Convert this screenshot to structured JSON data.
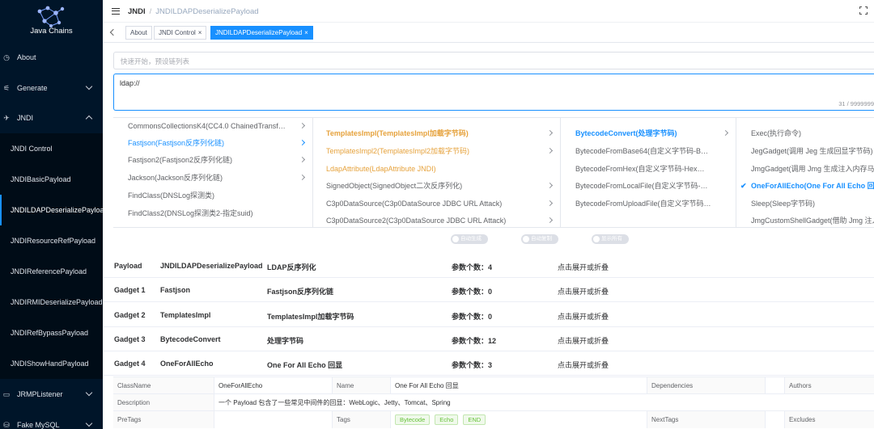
{
  "app": {
    "name": "Java Chains"
  },
  "sidebar": {
    "items": [
      {
        "label": "About",
        "icon": "clock-icon"
      },
      {
        "label": "Generate",
        "icon": "generate-icon"
      },
      {
        "label": "JNDI",
        "icon": "rocket-icon"
      },
      {
        "label": "JNDI Control"
      },
      {
        "label": "JNDIBasicPayload"
      },
      {
        "label": "JNDILDAPDeserializePayload"
      },
      {
        "label": "JNDIResourceRefPayload"
      },
      {
        "label": "JNDIReferencePayload"
      },
      {
        "label": "JNDIRMIDeserializePayload"
      },
      {
        "label": "JNDIRefBypassPayload"
      },
      {
        "label": "JNDIShowHandPayload"
      },
      {
        "label": "JRMPListener",
        "icon": "listener-icon"
      },
      {
        "label": "Fake MySQL",
        "icon": "database-icon"
      }
    ]
  },
  "header": {
    "crumb_root": "JNDI",
    "crumb_sep": "/",
    "crumb_current": "JNDILDAPDeserializePayload"
  },
  "tags": [
    {
      "label": "About"
    },
    {
      "label": "JNDI Control",
      "close": "×"
    },
    {
      "label": "JNDILDAPDeserializePayload",
      "close": "×"
    }
  ],
  "search": {
    "placeholder": "快速开始，预设链列表"
  },
  "editor": {
    "value": "ldap://",
    "count": "31 / 9999999"
  },
  "cascader": {
    "col1": [
      "CommonsCollectionsK4(CC4.0 ChainedTransfor…",
      "Fastjson(Fastjson反序列化链)",
      "Fastjson2(Fastjson2反序列化链)",
      "Jackson(Jackson反序列化链)",
      "FindClass(DNSLog探测类)",
      "FindClass2(DNSLog探测类2-指定suid)"
    ],
    "col2": [
      "TemplatesImpl(TemplatesImpl加载字节码)",
      "TemplatesImpl2(TemplatesImpl2加载字节码)",
      "LdapAttribute(LdapAttribute JNDI)",
      "SignedObject(SignedObject二次反序列化)",
      "C3p0DataSource(C3p0DataSource JDBC URL Attack)",
      "C3p0DataSource2(C3p0DataSource JDBC URL Attack)"
    ],
    "col3": [
      "BytecodeConvert(处理字节码)",
      "BytecodeFromBase64(自定义字节码-Bas…",
      "BytecodeFromHex(自定义字节码-Hex字符…",
      "BytecodeFromLocalFile(自定义字节码-本…",
      "BytecodeFromUploadFile(自定义字节码-…"
    ],
    "col4": [
      "Exec(执行命令)",
      "JegGadget(调用 Jeg 生成回显字节码)",
      "JmgGadget(调用 Jmg 生成注入内存马字节码)",
      "OneForAllEcho(One For All Echo 回显)",
      "Sleep(Sleep字节码)",
      "JmgCustomShellGadget(借助 Jmg 注入自定义内存马)"
    ],
    "check": "✔"
  },
  "switches": [
    "自动生成",
    "自动复制",
    "显示所有"
  ],
  "chains": [
    {
      "kind": "Payload",
      "name": "JNDILDAPDeserializePayload",
      "desc": "LDAP反序列化",
      "params": "参数个数：4",
      "toggle": "点击展开或折叠"
    },
    {
      "kind": "Gadget 1",
      "name": "Fastjson",
      "desc": "Fastjson反序列化链",
      "params": "参数个数：0",
      "toggle": "点击展开或折叠"
    },
    {
      "kind": "Gadget 2",
      "name": "TemplatesImpl",
      "desc": "TemplatesImpl加载字节码",
      "params": "参数个数：0",
      "toggle": "点击展开或折叠"
    },
    {
      "kind": "Gadget 3",
      "name": "BytecodeConvert",
      "desc": "处理字节码",
      "params": "参数个数：12",
      "toggle": "点击展开或折叠"
    },
    {
      "kind": "Gadget 4",
      "name": "OneForAllEcho",
      "desc": "One For All Echo 回显",
      "params": "参数个数：3",
      "toggle": "点击展开或折叠"
    }
  ],
  "detail": {
    "classname_label": "ClassName",
    "classname": "OneForAllEcho",
    "name_label": "Name",
    "name": "One For All Echo 回显",
    "dependencies_label": "Dependencies",
    "authors_label": "Authors",
    "description_label": "Description",
    "description": "一个 Payload 包含了一些常见中间件的回显：WebLogic、Jetty、Tomcat、Spring",
    "pretags_label": "PreTags",
    "tags_label": "Tags",
    "tags": [
      "Bytecode",
      "Echo",
      "END"
    ],
    "nexttags_label": "NextTags",
    "excludes_label": "Excludes"
  },
  "colors": {
    "sidebar_bg": "#001529",
    "accent": "#1890ff",
    "orange": "#e6a23c",
    "tag_green": "#67c23a"
  }
}
